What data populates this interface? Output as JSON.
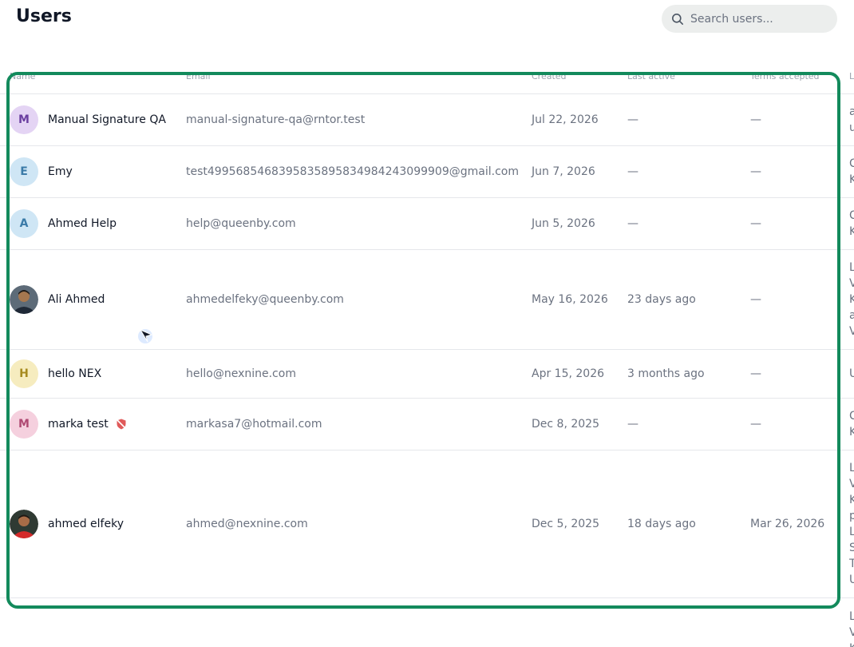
{
  "page": {
    "title": "Users"
  },
  "search": {
    "placeholder": "Search users..."
  },
  "table": {
    "columns": [
      "Name",
      "Email",
      "Created",
      "Last active",
      "Terms accepted",
      "L"
    ],
    "rows": [
      {
        "initial": "M",
        "avatar_bg": "#e4d4f4",
        "avatar_fg": "#6b3fa0",
        "name": "Manual Signature QA",
        "email": "manual-signature-qa@rntor.test",
        "created": "Jul 22, 2026",
        "last_active": "—",
        "terms": "—",
        "extra": [
          "a",
          "u"
        ]
      },
      {
        "initial": "E",
        "avatar_bg": "#cfe6f5",
        "avatar_fg": "#3b7ba8",
        "name": "Emy",
        "email": "test4995685468395835895834984243099909@gmail.com",
        "created": "Jun 7, 2026",
        "last_active": "—",
        "terms": "—",
        "extra": [
          "C",
          "K"
        ]
      },
      {
        "initial": "A",
        "avatar_bg": "#cfe6f5",
        "avatar_fg": "#3b7ba8",
        "name": "Ahmed Help",
        "email": "help@queenby.com",
        "created": "Jun 5, 2026",
        "last_active": "—",
        "terms": "—",
        "extra": [
          "C",
          "K"
        ]
      },
      {
        "initial": "",
        "avatar_bg": "",
        "avatar_fg": "",
        "name": "Ali Ahmed",
        "email": "ahmedelfeky@queenby.com",
        "created": "May 16, 2026",
        "last_active": "23 days ago",
        "terms": "—",
        "extra": [
          "L",
          "V",
          "K",
          "a",
          "V"
        ]
      },
      {
        "initial": "H",
        "avatar_bg": "#f6ecbf",
        "avatar_fg": "#a68a1f",
        "name": "hello NEX",
        "email": "hello@nexnine.com",
        "created": "Apr 15, 2026",
        "last_active": "3 months ago",
        "terms": "—",
        "extra": [
          "U"
        ]
      },
      {
        "initial": "M",
        "avatar_bg": "#f5d0de",
        "avatar_fg": "#b04a73",
        "name": "marka test",
        "email": "markasa7@hotmail.com",
        "created": "Dec 8, 2025",
        "last_active": "—",
        "terms": "—",
        "extra": [
          "C",
          "K"
        ]
      },
      {
        "initial": "",
        "avatar_bg": "",
        "avatar_fg": "",
        "name": "ahmed elfeky",
        "email": "ahmed@nexnine.com",
        "created": "Dec 5, 2025",
        "last_active": "18 days ago",
        "terms": "Mar 26, 2026",
        "extra": [
          "L",
          "V",
          "K",
          "p",
          "L",
          "S",
          "T",
          "U"
        ]
      },
      {
        "initial": "",
        "avatar_bg": "",
        "avatar_fg": "",
        "name": "",
        "email": "",
        "created": "",
        "last_active": "",
        "terms": "",
        "extra": [
          "L",
          "V",
          "K"
        ]
      }
    ]
  },
  "colors": {
    "accent": "#138a5c",
    "muted": "#6b7280",
    "border": "#e5e7eb",
    "blocked": "#e05a5a"
  },
  "icons": {
    "search": "search-icon",
    "blocked": "shield-off-icon",
    "cursor": "cursor-icon"
  }
}
